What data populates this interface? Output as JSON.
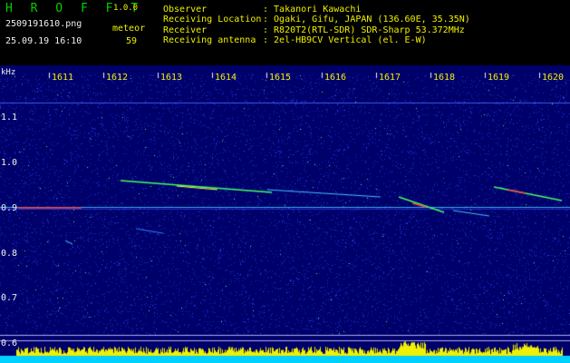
{
  "header": {
    "app_name": "H R O F F T",
    "app_version": "1.0.0",
    "filename": "2509191610.png",
    "datetime": "25.09.19 16:10",
    "meteor_label": "meteor",
    "meteor_count": "59",
    "info": [
      {
        "label": "Observer",
        "value": ": Takanori Kawachi"
      },
      {
        "label": "Receiving Location",
        "value": ": Ogaki, Gifu, JAPAN (136.60E, 35.35N)"
      },
      {
        "label": "Receiver",
        "value": ": R820T2(RTL-SDR) SDR-Sharp 53.372MHz"
      },
      {
        "label": "Receiving antenna",
        "value": ": 2el-HB9CV Vertical (el. E-W)"
      }
    ]
  },
  "spectrogram": {
    "unit": "kHz",
    "time_labels": [
      "1611",
      "1612",
      "1613",
      "1614",
      "1615",
      "1616",
      "1617",
      "1618",
      "1619",
      "1620"
    ],
    "freq_labels": [
      "1.1",
      "1.0",
      "0.9",
      "0.8",
      "0.7",
      "0.6"
    ],
    "colors": {
      "background": "#00006a",
      "signal": "#30ff30",
      "hot": "#ff3030",
      "level_bar": "#f0f000",
      "level_base": "#00d0ff"
    }
  }
}
